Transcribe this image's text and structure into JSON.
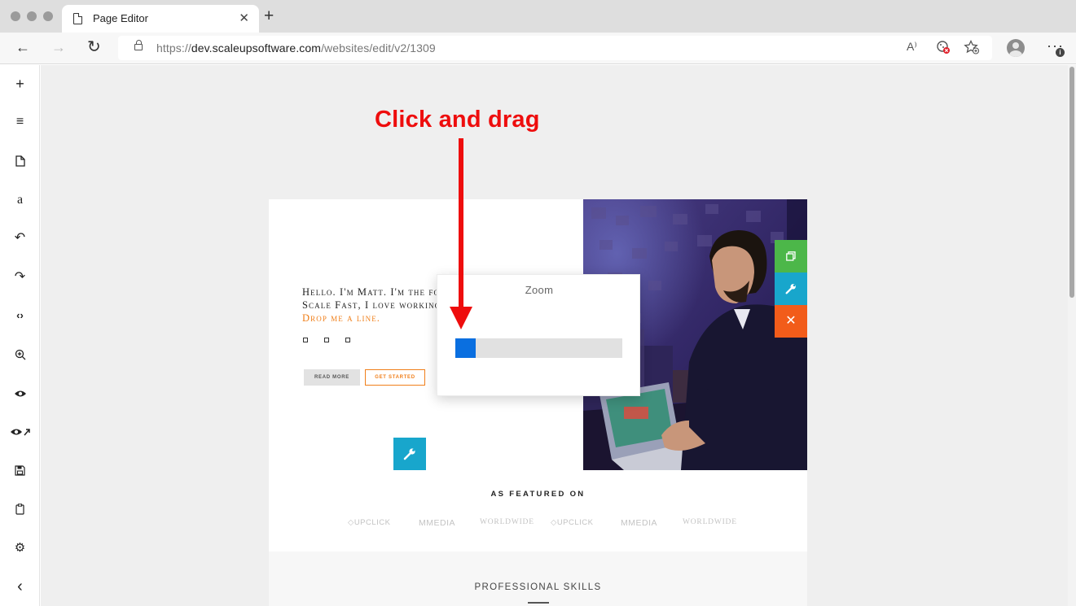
{
  "browser": {
    "tab_title": "Page Editor",
    "tab_close": "✕",
    "new_tab": "+",
    "back": "←",
    "forward": "→",
    "reload": "↻",
    "url_scheme": "https://",
    "url_host": "dev.scaleupsoftware.com",
    "url_path": "/websites/edit/v2/1309",
    "read_aloud": "A⁾",
    "more": "···",
    "more_badge": "i"
  },
  "sidebar": {
    "items": [
      {
        "name": "add",
        "glyph": "+"
      },
      {
        "name": "align",
        "glyph": "≡"
      },
      {
        "name": "page",
        "glyph": "🗋"
      },
      {
        "name": "text",
        "glyph": "a"
      },
      {
        "name": "undo",
        "glyph": "↶"
      },
      {
        "name": "redo",
        "glyph": "↷"
      },
      {
        "name": "code",
        "glyph": "‹›"
      },
      {
        "name": "zoom",
        "glyph": "⊕"
      },
      {
        "name": "preview",
        "glyph": "◉"
      },
      {
        "name": "preview-external",
        "glyph": "◉↗"
      },
      {
        "name": "save",
        "glyph": "▣"
      },
      {
        "name": "clipboard",
        "glyph": "▯"
      },
      {
        "name": "settings",
        "glyph": "⚙"
      },
      {
        "name": "collapse",
        "glyph": "‹"
      }
    ]
  },
  "annotation": {
    "label": "Click and drag",
    "color": "#ee0d0d"
  },
  "hero": {
    "intro_line1": "Hello. I'm Matt. I'm the fou",
    "intro_line2": "Scale Fast, I love working",
    "intro_link": "Drop me a line.",
    "read_more": "READ MORE",
    "get_started": "GET STARTED",
    "wrench": "🔧",
    "accent_color": "#f07f1a"
  },
  "side_actions": {
    "copy": "⧉",
    "settings": "🔧",
    "delete": "✕",
    "colors": [
      "#4cb749",
      "#18a6cc",
      "#f25c1a"
    ]
  },
  "featured": {
    "title": "AS FEATURED ON",
    "logos": [
      "UPCLICK",
      "MMEDIA",
      "WORLDWIDE",
      "UPCLICK",
      "MMEDIA",
      "WORLDWIDE"
    ]
  },
  "skills": {
    "title": "PROFESSIONAL SKILLS"
  },
  "zoom": {
    "title": "Zoom",
    "level": 0.12,
    "fill_color": "#0a6fe0"
  }
}
